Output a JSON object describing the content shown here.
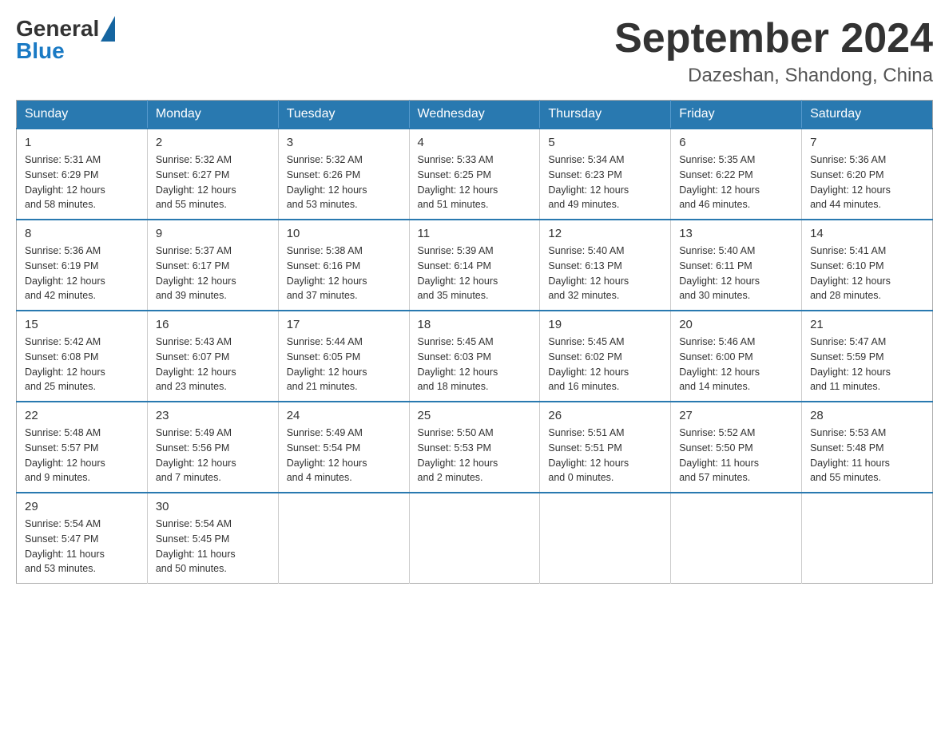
{
  "header": {
    "logo_general": "General",
    "logo_blue": "Blue",
    "month_title": "September 2024",
    "location": "Dazeshan, Shandong, China"
  },
  "weekdays": [
    "Sunday",
    "Monday",
    "Tuesday",
    "Wednesday",
    "Thursday",
    "Friday",
    "Saturday"
  ],
  "weeks": [
    [
      {
        "day": "1",
        "sunrise": "5:31 AM",
        "sunset": "6:29 PM",
        "daylight": "12 hours and 58 minutes."
      },
      {
        "day": "2",
        "sunrise": "5:32 AM",
        "sunset": "6:27 PM",
        "daylight": "12 hours and 55 minutes."
      },
      {
        "day": "3",
        "sunrise": "5:32 AM",
        "sunset": "6:26 PM",
        "daylight": "12 hours and 53 minutes."
      },
      {
        "day": "4",
        "sunrise": "5:33 AM",
        "sunset": "6:25 PM",
        "daylight": "12 hours and 51 minutes."
      },
      {
        "day": "5",
        "sunrise": "5:34 AM",
        "sunset": "6:23 PM",
        "daylight": "12 hours and 49 minutes."
      },
      {
        "day": "6",
        "sunrise": "5:35 AM",
        "sunset": "6:22 PM",
        "daylight": "12 hours and 46 minutes."
      },
      {
        "day": "7",
        "sunrise": "5:36 AM",
        "sunset": "6:20 PM",
        "daylight": "12 hours and 44 minutes."
      }
    ],
    [
      {
        "day": "8",
        "sunrise": "5:36 AM",
        "sunset": "6:19 PM",
        "daylight": "12 hours and 42 minutes."
      },
      {
        "day": "9",
        "sunrise": "5:37 AM",
        "sunset": "6:17 PM",
        "daylight": "12 hours and 39 minutes."
      },
      {
        "day": "10",
        "sunrise": "5:38 AM",
        "sunset": "6:16 PM",
        "daylight": "12 hours and 37 minutes."
      },
      {
        "day": "11",
        "sunrise": "5:39 AM",
        "sunset": "6:14 PM",
        "daylight": "12 hours and 35 minutes."
      },
      {
        "day": "12",
        "sunrise": "5:40 AM",
        "sunset": "6:13 PM",
        "daylight": "12 hours and 32 minutes."
      },
      {
        "day": "13",
        "sunrise": "5:40 AM",
        "sunset": "6:11 PM",
        "daylight": "12 hours and 30 minutes."
      },
      {
        "day": "14",
        "sunrise": "5:41 AM",
        "sunset": "6:10 PM",
        "daylight": "12 hours and 28 minutes."
      }
    ],
    [
      {
        "day": "15",
        "sunrise": "5:42 AM",
        "sunset": "6:08 PM",
        "daylight": "12 hours and 25 minutes."
      },
      {
        "day": "16",
        "sunrise": "5:43 AM",
        "sunset": "6:07 PM",
        "daylight": "12 hours and 23 minutes."
      },
      {
        "day": "17",
        "sunrise": "5:44 AM",
        "sunset": "6:05 PM",
        "daylight": "12 hours and 21 minutes."
      },
      {
        "day": "18",
        "sunrise": "5:45 AM",
        "sunset": "6:03 PM",
        "daylight": "12 hours and 18 minutes."
      },
      {
        "day": "19",
        "sunrise": "5:45 AM",
        "sunset": "6:02 PM",
        "daylight": "12 hours and 16 minutes."
      },
      {
        "day": "20",
        "sunrise": "5:46 AM",
        "sunset": "6:00 PM",
        "daylight": "12 hours and 14 minutes."
      },
      {
        "day": "21",
        "sunrise": "5:47 AM",
        "sunset": "5:59 PM",
        "daylight": "12 hours and 11 minutes."
      }
    ],
    [
      {
        "day": "22",
        "sunrise": "5:48 AM",
        "sunset": "5:57 PM",
        "daylight": "12 hours and 9 minutes."
      },
      {
        "day": "23",
        "sunrise": "5:49 AM",
        "sunset": "5:56 PM",
        "daylight": "12 hours and 7 minutes."
      },
      {
        "day": "24",
        "sunrise": "5:49 AM",
        "sunset": "5:54 PM",
        "daylight": "12 hours and 4 minutes."
      },
      {
        "day": "25",
        "sunrise": "5:50 AM",
        "sunset": "5:53 PM",
        "daylight": "12 hours and 2 minutes."
      },
      {
        "day": "26",
        "sunrise": "5:51 AM",
        "sunset": "5:51 PM",
        "daylight": "12 hours and 0 minutes."
      },
      {
        "day": "27",
        "sunrise": "5:52 AM",
        "sunset": "5:50 PM",
        "daylight": "11 hours and 57 minutes."
      },
      {
        "day": "28",
        "sunrise": "5:53 AM",
        "sunset": "5:48 PM",
        "daylight": "11 hours and 55 minutes."
      }
    ],
    [
      {
        "day": "29",
        "sunrise": "5:54 AM",
        "sunset": "5:47 PM",
        "daylight": "11 hours and 53 minutes."
      },
      {
        "day": "30",
        "sunrise": "5:54 AM",
        "sunset": "5:45 PM",
        "daylight": "11 hours and 50 minutes."
      },
      null,
      null,
      null,
      null,
      null
    ]
  ]
}
